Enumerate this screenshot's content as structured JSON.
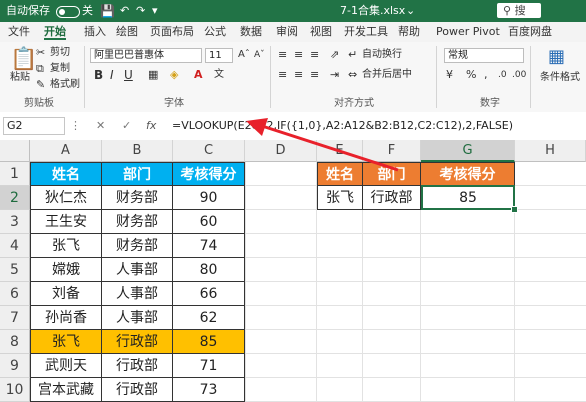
{
  "titlebar": {
    "autosave": "自动保存",
    "autosave_state": "关",
    "filename": "7-1合集.xlsx",
    "search": "搜"
  },
  "menu": [
    "文件",
    "开始",
    "插入",
    "绘图",
    "页面布局",
    "公式",
    "数据",
    "审阅",
    "视图",
    "开发工具",
    "帮助",
    "Power Pivot",
    "百度网盘"
  ],
  "ribbon": {
    "paste": "粘贴",
    "cut": "剪切",
    "copy": "复制",
    "format_painter": "格式刷",
    "clipboard_group": "剪贴板",
    "font_name": "阿里巴巴普惠体",
    "font_size": "11",
    "font_group": "字体",
    "wrap_text": "自动换行",
    "merge_center": "合并后居中",
    "align_group": "对齐方式",
    "number_format": "常规",
    "number_group": "数字",
    "cond_format": "条件格式",
    "bold": "B",
    "italic": "I",
    "underline": "U"
  },
  "formula_bar": {
    "name_box": "G2",
    "fx": "fx",
    "formula": "=VLOOKUP(E2&F2,IF({1,0},A2:A12&B2:B12,C2:C12),2,FALSE)"
  },
  "columns": [
    "A",
    "B",
    "C",
    "D",
    "E",
    "F",
    "G",
    "H"
  ],
  "rows": [
    "1",
    "2",
    "3",
    "4",
    "5",
    "6",
    "7",
    "8",
    "9",
    "10"
  ],
  "table": {
    "headers": [
      "姓名",
      "部门",
      "考核得分"
    ],
    "rows": [
      [
        "狄仁杰",
        "财务部",
        "90"
      ],
      [
        "王生安",
        "财务部",
        "60"
      ],
      [
        "张飞",
        "财务部",
        "74"
      ],
      [
        "嫦娥",
        "人事部",
        "80"
      ],
      [
        "刘备",
        "人事部",
        "66"
      ],
      [
        "孙尚香",
        "人事部",
        "62"
      ],
      [
        "张飞",
        "行政部",
        "85"
      ],
      [
        "武则天",
        "行政部",
        "71"
      ],
      [
        "宫本武藏",
        "行政部",
        "73"
      ]
    ]
  },
  "lookup": {
    "headers": [
      "姓名",
      "部门",
      "考核得分"
    ],
    "row": [
      "张飞",
      "行政部",
      "85"
    ]
  },
  "colors": {
    "excel_green": "#217346",
    "header_blue": "#00b0f0",
    "header_orange": "#ed7d31",
    "highlight": "#ffc000",
    "arrow_red": "#e8212b"
  }
}
